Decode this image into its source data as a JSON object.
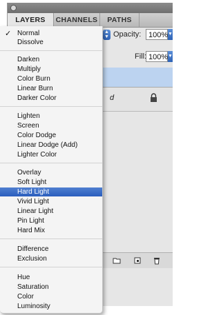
{
  "panel": {
    "tabs": [
      "LAYERS",
      "CHANNELS",
      "PATHS"
    ],
    "opacity_label": "Opacity:",
    "opacity_value": "100%",
    "fill_label": "Fill:",
    "fill_value": "100%",
    "layer_fragment": "d"
  },
  "blend_menu": {
    "checked_item": "Normal",
    "highlighted_item": "Hard Light",
    "groups": [
      [
        "Normal",
        "Dissolve"
      ],
      [
        "Darken",
        "Multiply",
        "Color Burn",
        "Linear Burn",
        "Darker Color"
      ],
      [
        "Lighten",
        "Screen",
        "Color Dodge",
        "Linear Dodge (Add)",
        "Lighter Color"
      ],
      [
        "Overlay",
        "Soft Light",
        "Hard Light",
        "Vivid Light",
        "Linear Light",
        "Pin Light",
        "Hard Mix"
      ],
      [
        "Difference",
        "Exclusion"
      ],
      [
        "Hue",
        "Saturation",
        "Color",
        "Luminosity"
      ]
    ]
  },
  "icons": {
    "lock": "lock-icon",
    "folder": "new-group-icon",
    "new_layer": "new-layer-icon",
    "trash": "trash-icon"
  },
  "colors": {
    "highlight": "#2f63c2",
    "selected_layer": "#bcd3f0"
  }
}
